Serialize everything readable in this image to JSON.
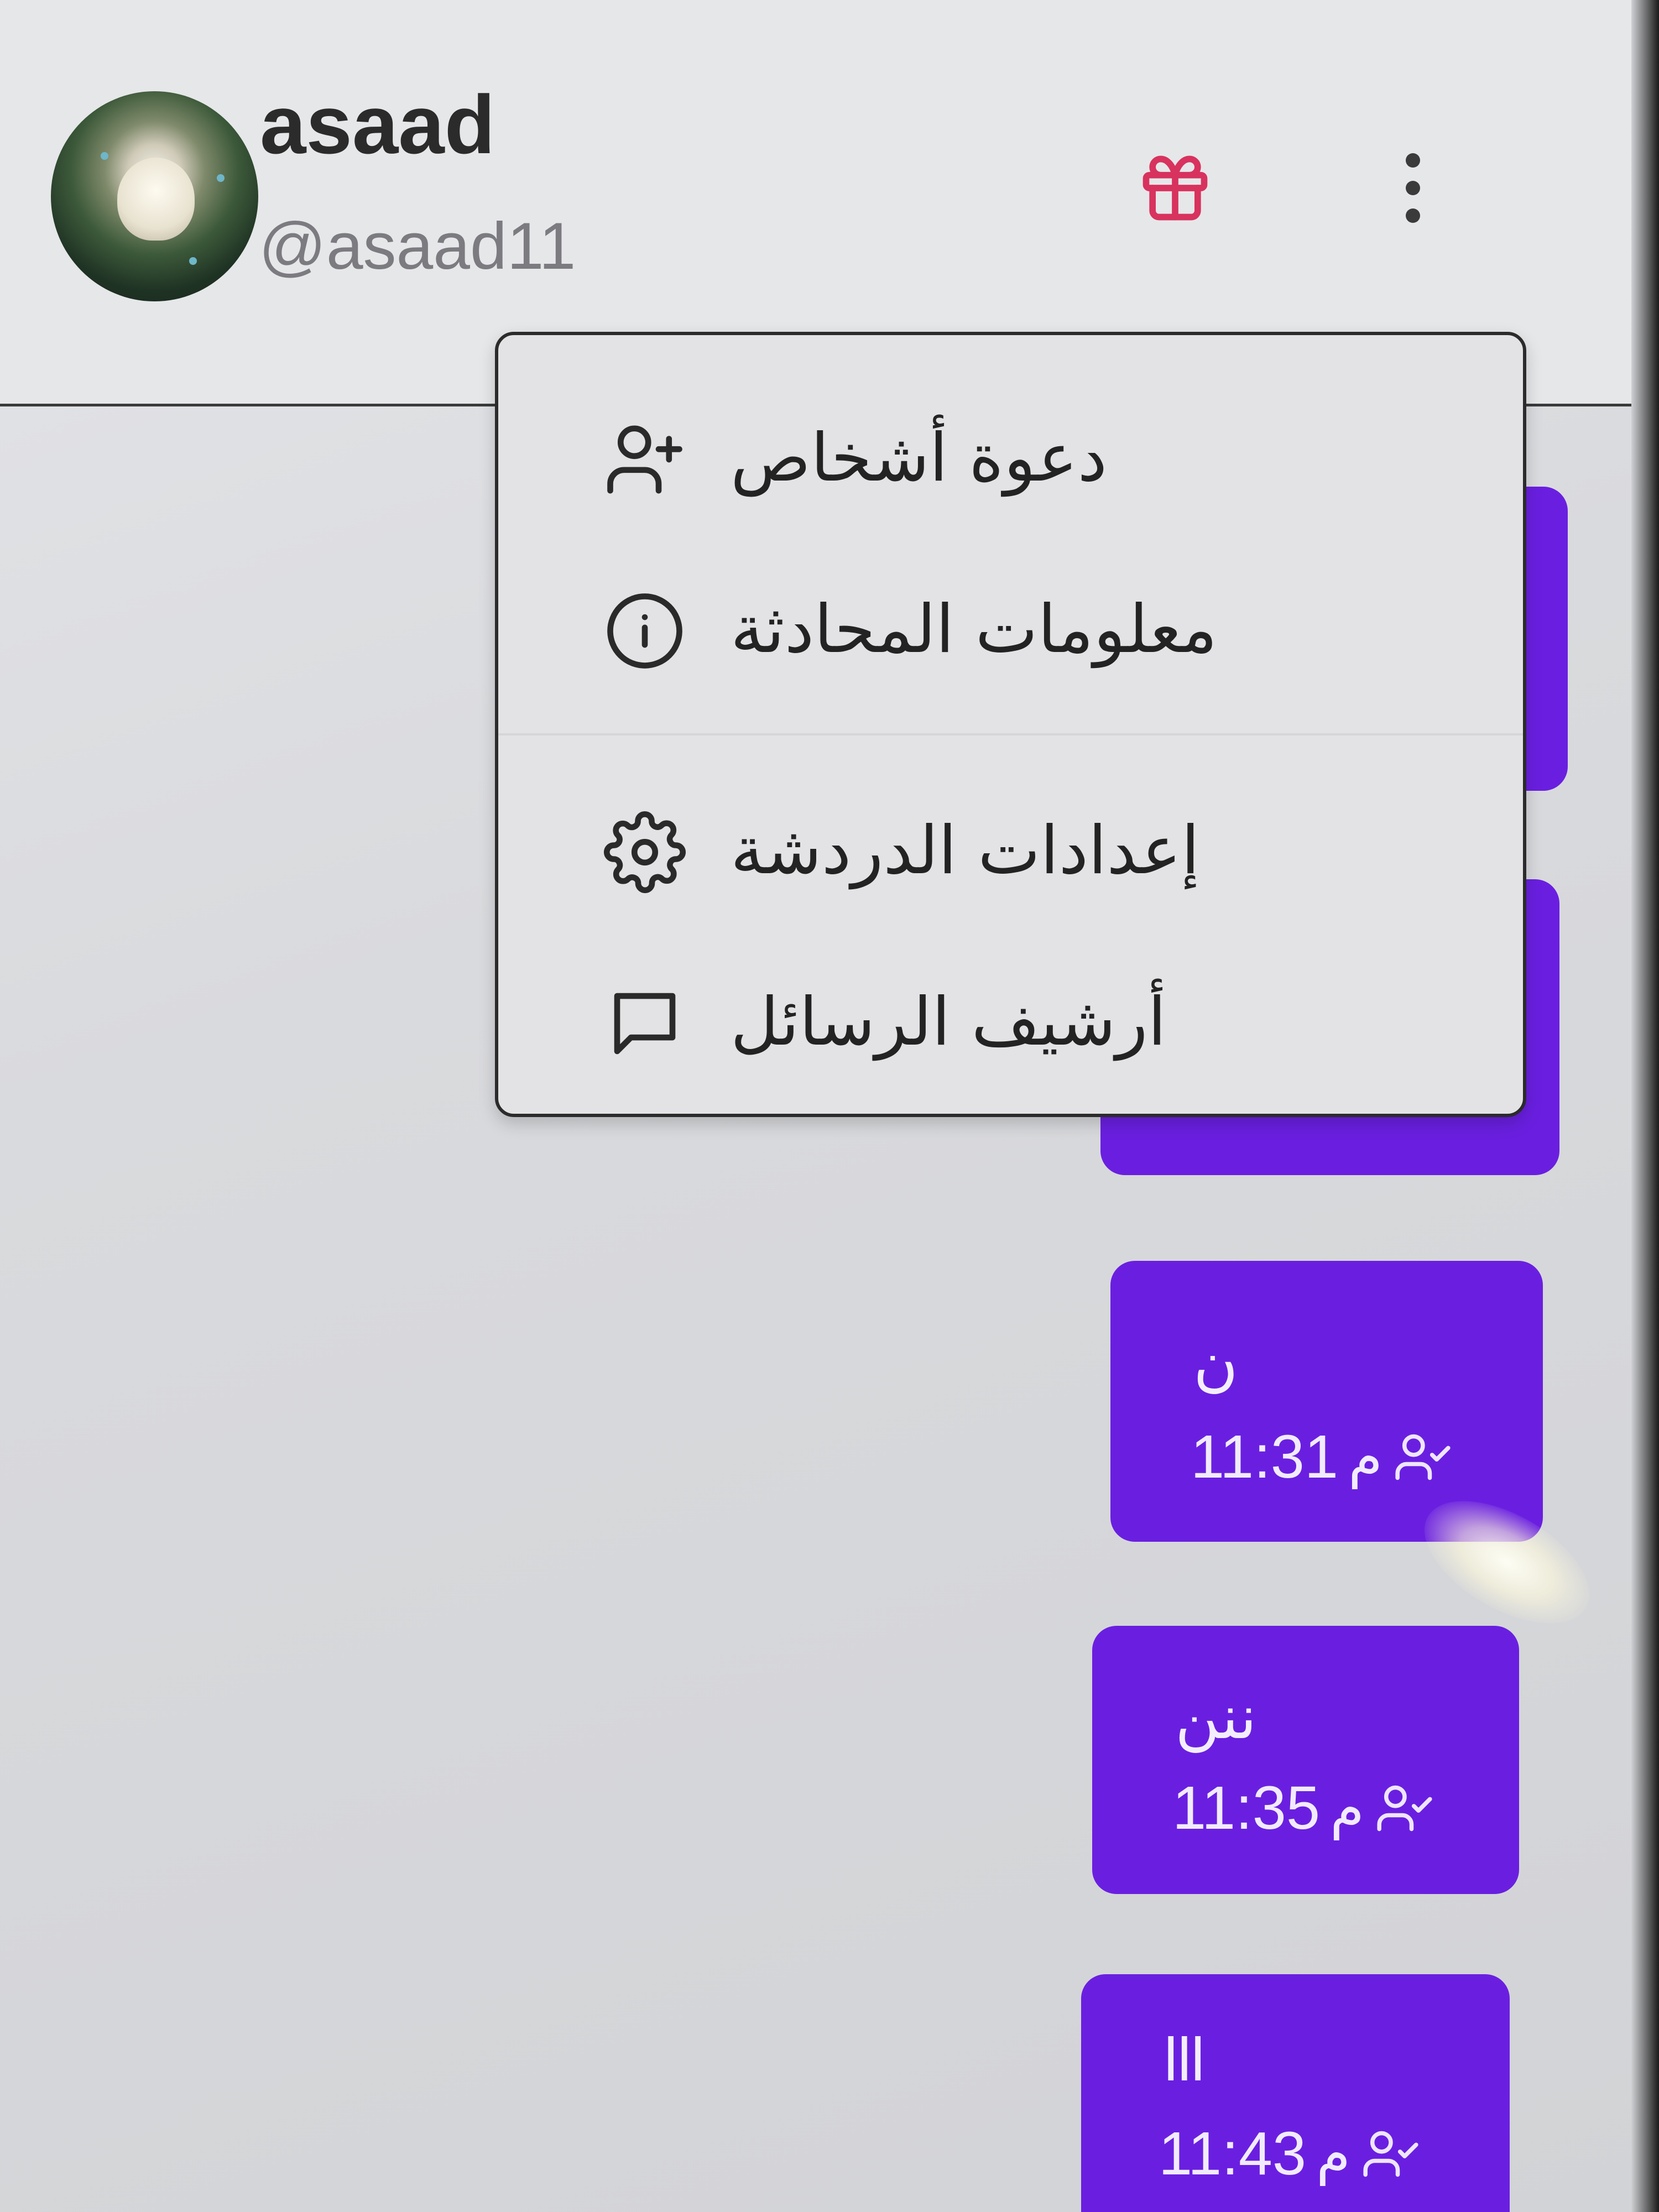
{
  "header": {
    "name": "asaad",
    "handle": "@asaad11",
    "gift_icon": "gift-icon",
    "more_icon": "more-vertical-icon"
  },
  "menu": {
    "items": [
      {
        "label": "دعوة أشخاص",
        "icon": "add-user-icon"
      },
      {
        "label": "معلومات المحادثة",
        "icon": "info-icon"
      },
      {
        "label": "إعدادات الدردشة",
        "icon": "gear-icon"
      },
      {
        "label": "أرشيف الرسائل",
        "icon": "chat-bubble-icon"
      }
    ]
  },
  "messages": [
    {
      "text": "ن",
      "time": "11:31",
      "suffix": "م",
      "status_icon": "users-check-icon"
    },
    {
      "text": "ننن",
      "time": "11:35",
      "suffix": "م",
      "status_icon": "users-check-icon"
    },
    {
      "text": "lll",
      "time": "11:43",
      "suffix": "م",
      "status_icon": "users-check-icon"
    }
  ],
  "colors": {
    "bubble": "#6a1fe0",
    "gift_accent": "#d8325e",
    "header_bg": "#e6e7e9"
  }
}
